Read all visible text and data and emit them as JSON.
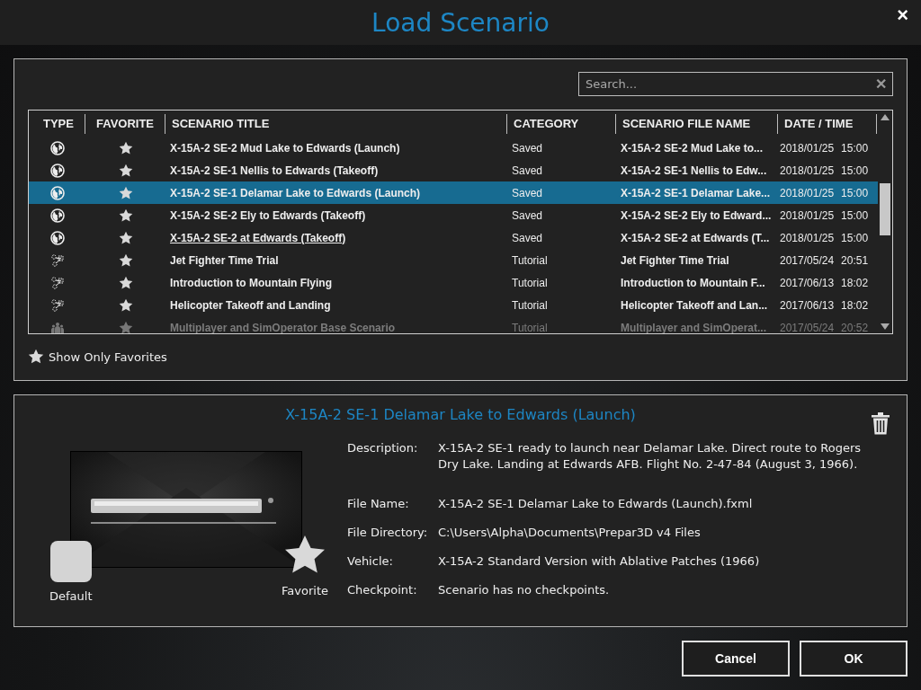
{
  "window": {
    "title": "Load Scenario",
    "close": "×"
  },
  "search": {
    "placeholder": "Search...",
    "clear": "✕"
  },
  "table": {
    "columns": [
      "TYPE",
      "FAVORITE",
      "SCENARIO TITLE",
      "CATEGORY",
      "SCENARIO FILE NAME",
      "DATE / TIME"
    ],
    "rows": [
      {
        "kind": "saved",
        "favorite": true,
        "title": "X-15A-2 SE-2 Mud Lake to Edwards (Launch)",
        "category": "Saved",
        "file": "X-15A-2 SE-2 Mud Lake to...",
        "date": "2018/01/25",
        "time": "15:00",
        "selected": false,
        "hovered": false,
        "dimmed": false
      },
      {
        "kind": "saved",
        "favorite": true,
        "title": "X-15A-2 SE-1 Nellis to Edwards (Takeoff)",
        "category": "Saved",
        "file": "X-15A-2 SE-1 Nellis to Edw...",
        "date": "2018/01/25",
        "time": "15:00",
        "selected": false,
        "hovered": false,
        "dimmed": false
      },
      {
        "kind": "saved",
        "favorite": true,
        "title": "X-15A-2 SE-1 Delamar Lake to Edwards (Launch)",
        "category": "Saved",
        "file": "X-15A-2 SE-1 Delamar Lake...",
        "date": "2018/01/25",
        "time": "15:00",
        "selected": true,
        "hovered": false,
        "dimmed": false
      },
      {
        "kind": "saved",
        "favorite": true,
        "title": "X-15A-2 SE-2 Ely to Edwards (Takeoff)",
        "category": "Saved",
        "file": "X-15A-2 SE-2 Ely to Edward...",
        "date": "2018/01/25",
        "time": "15:00",
        "selected": false,
        "hovered": false,
        "dimmed": false
      },
      {
        "kind": "saved",
        "favorite": true,
        "title": "X-15A-2 SE-2 at Edwards (Takeoff)",
        "category": "Saved",
        "file": "X-15A-2 SE-2 at Edwards (T...",
        "date": "2018/01/25",
        "time": "15:00",
        "selected": false,
        "hovered": true,
        "dimmed": false
      },
      {
        "kind": "tutorial",
        "favorite": true,
        "title": "Jet Fighter Time Trial",
        "category": "Tutorial",
        "file": "Jet Fighter Time Trial",
        "date": "2017/05/24",
        "time": "20:51",
        "selected": false,
        "hovered": false,
        "dimmed": false
      },
      {
        "kind": "tutorial",
        "favorite": true,
        "title": "Introduction to Mountain Flying",
        "category": "Tutorial",
        "file": "Introduction to Mountain F...",
        "date": "2017/06/13",
        "time": "18:02",
        "selected": false,
        "hovered": false,
        "dimmed": false
      },
      {
        "kind": "tutorial",
        "favorite": true,
        "title": "Helicopter Takeoff and Landing",
        "category": "Tutorial",
        "file": "Helicopter Takeoff and Lan...",
        "date": "2017/06/13",
        "time": "18:02",
        "selected": false,
        "hovered": false,
        "dimmed": false
      },
      {
        "kind": "multiplayer",
        "favorite": true,
        "title": "Multiplayer and SimOperator Base Scenario",
        "category": "Tutorial",
        "file": "Multiplayer and SimOperat...",
        "date": "2017/05/24",
        "time": "20:52",
        "selected": false,
        "hovered": false,
        "dimmed": true
      }
    ]
  },
  "favorites_filter": {
    "label": "Show Only Favorites",
    "checked": false
  },
  "details": {
    "heading": "X-15A-2 SE-1 Delamar Lake to Edwards (Launch)",
    "default_label": "Default",
    "favorite_label": "Favorite",
    "favorite": true,
    "fields": [
      {
        "label": "Description:",
        "value": "X-15A-2 SE-1 ready to launch near Delamar Lake. Direct route to Rogers Dry Lake. Landing at Edwards AFB. Flight No. 2-47-84 (August 3, 1966)."
      },
      {
        "label": "File Name:",
        "value": "X-15A-2 SE-1 Delamar Lake to Edwards (Launch).fxml"
      },
      {
        "label": "File Directory:",
        "value": "C:\\Users\\Alpha\\Documents\\Prepar3D v4 Files"
      },
      {
        "label": "Vehicle:",
        "value": "X-15A-2 Standard Version with Ablative Patches (1966)"
      },
      {
        "label": "Checkpoint:",
        "value": "Scenario has no checkpoints."
      }
    ]
  },
  "buttons": [
    "Cancel",
    "OK"
  ]
}
